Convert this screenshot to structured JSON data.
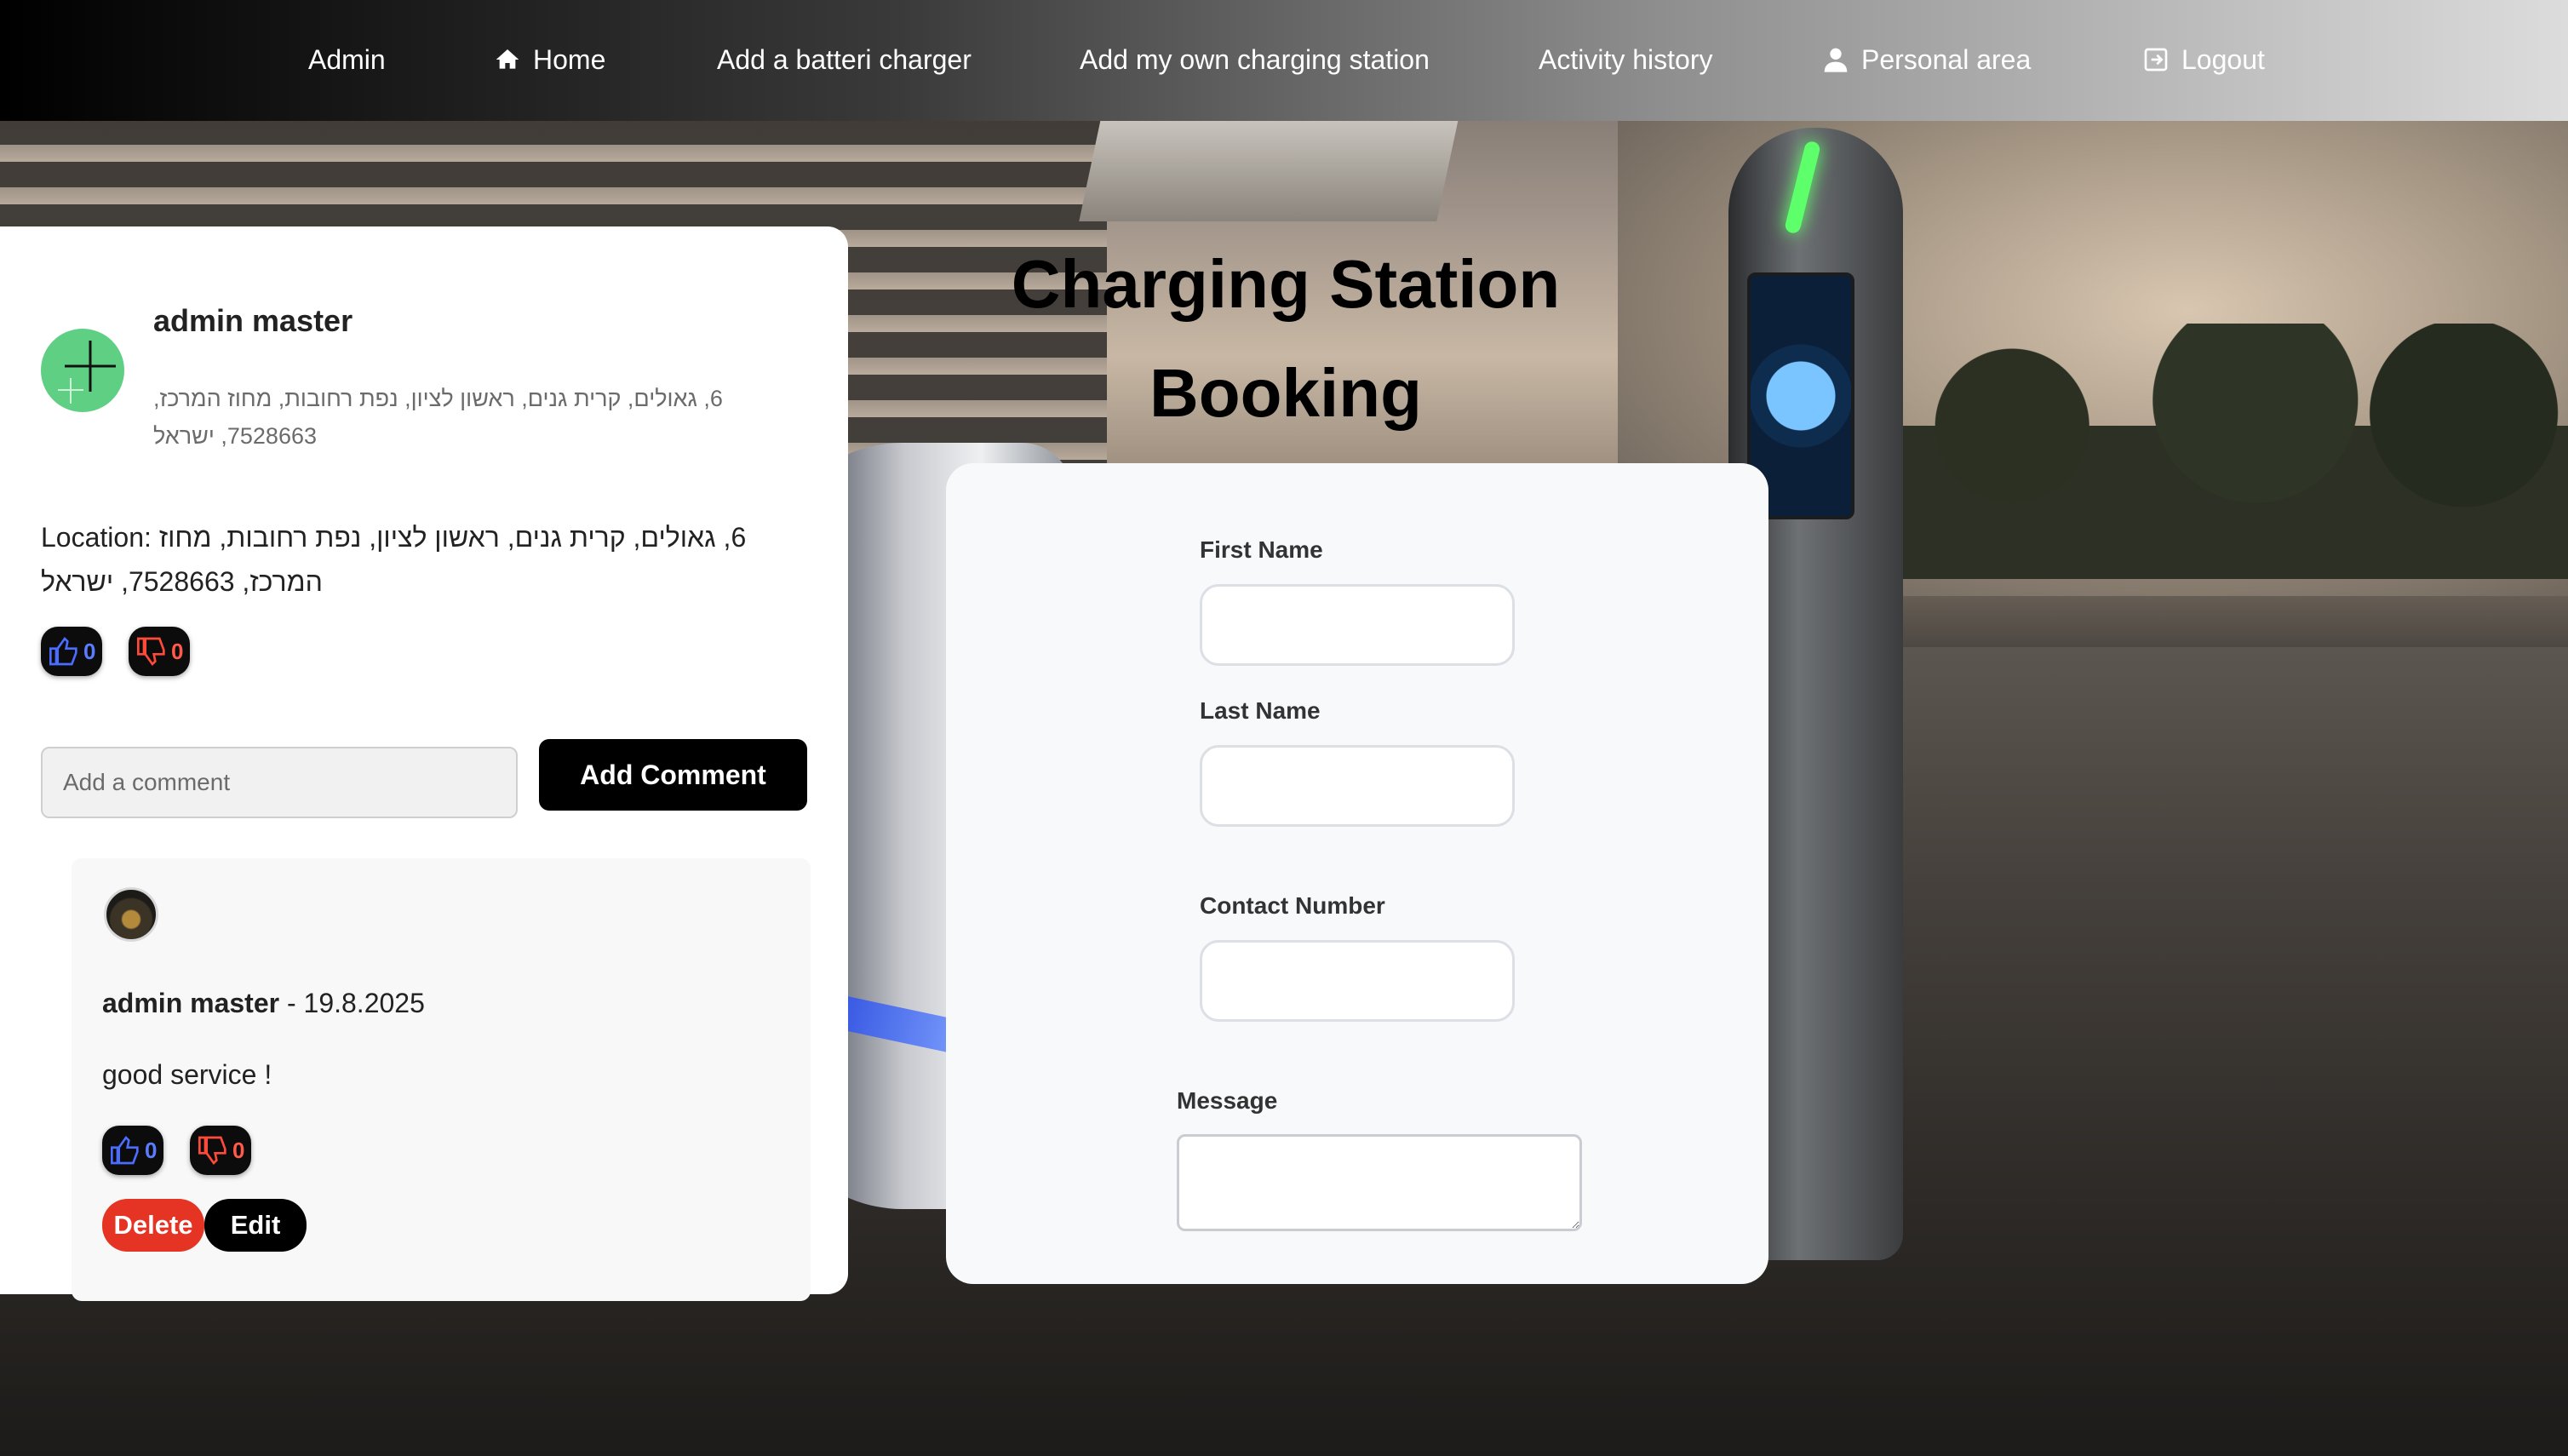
{
  "nav": {
    "items": [
      {
        "label": "Admin",
        "icon": ""
      },
      {
        "label": "Home",
        "icon": "home-icon"
      },
      {
        "label": "Add a batteri charger",
        "icon": ""
      },
      {
        "label": "Add my own charging station",
        "icon": ""
      },
      {
        "label": "Activity history",
        "icon": ""
      },
      {
        "label": "Personal area",
        "icon": "user-icon"
      },
      {
        "label": "Logout",
        "icon": "logout-icon"
      }
    ]
  },
  "station": {
    "owner_name": "admin master",
    "address": "6, גאולים, קרית גנים, ראשון לציון, נפת רחובות, מחוז המרכז, 7528663, ישראל",
    "location_label": "Location:",
    "location_value": "6, גאולים, קרית גנים, ראשון לציון, נפת רחובות, מחוז המרכז, 7528663, ישראל",
    "likes": "0",
    "dislikes": "0"
  },
  "comment_form": {
    "placeholder": "Add a comment",
    "submit_label": "Add Comment"
  },
  "comments": [
    {
      "author": "admin master",
      "separator": " - ",
      "date": "19.8.2025",
      "text": "good service !",
      "likes": "0",
      "dislikes": "0",
      "delete_label": "Delete",
      "edit_label": "Edit"
    }
  ],
  "booking": {
    "title_line1": "Charging Station",
    "title_line2": "Booking",
    "first_name_label": "First Name",
    "last_name_label": "Last Name",
    "contact_label": "Contact Number",
    "message_label": "Message",
    "first_name_value": "",
    "last_name_value": "",
    "contact_value": "",
    "message_value": ""
  },
  "colors": {
    "like": "#5a7dff",
    "dislike": "#ff5a4a",
    "delete": "#e53424",
    "avatar_add": "#5fd083"
  }
}
